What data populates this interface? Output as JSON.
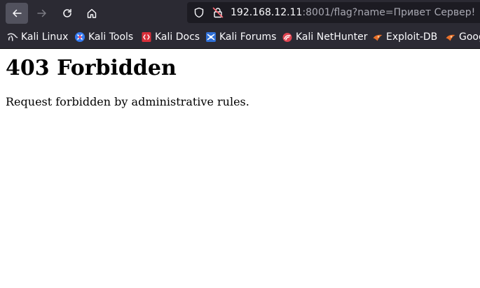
{
  "browser": {
    "url_host": "192.168.12.11",
    "url_rest": ":8001/flag?name=Привет Сервер!",
    "icons": {
      "back": "arrow-left-icon",
      "forward": "arrow-right-icon",
      "reload": "reload-icon",
      "home": "home-icon",
      "shield": "shield-icon",
      "insecure": "insecure-lock-icon"
    }
  },
  "bookmarks": [
    {
      "label": "Kali Linux",
      "icon": "kali-dragon-icon"
    },
    {
      "label": "Kali Tools",
      "icon": "kali-tools-icon"
    },
    {
      "label": "Kali Docs",
      "icon": "kali-docs-icon"
    },
    {
      "label": "Kali Forums",
      "icon": "kali-forums-icon"
    },
    {
      "label": "Kali NetHunter",
      "icon": "kali-nethunter-icon"
    },
    {
      "label": "Exploit-DB",
      "icon": "exploit-db-icon"
    },
    {
      "label": "Google Hacking DB",
      "icon": "google-hacking-db-icon"
    }
  ],
  "page": {
    "heading": "403 Forbidden",
    "message": "Request forbidden by administrative rules."
  }
}
